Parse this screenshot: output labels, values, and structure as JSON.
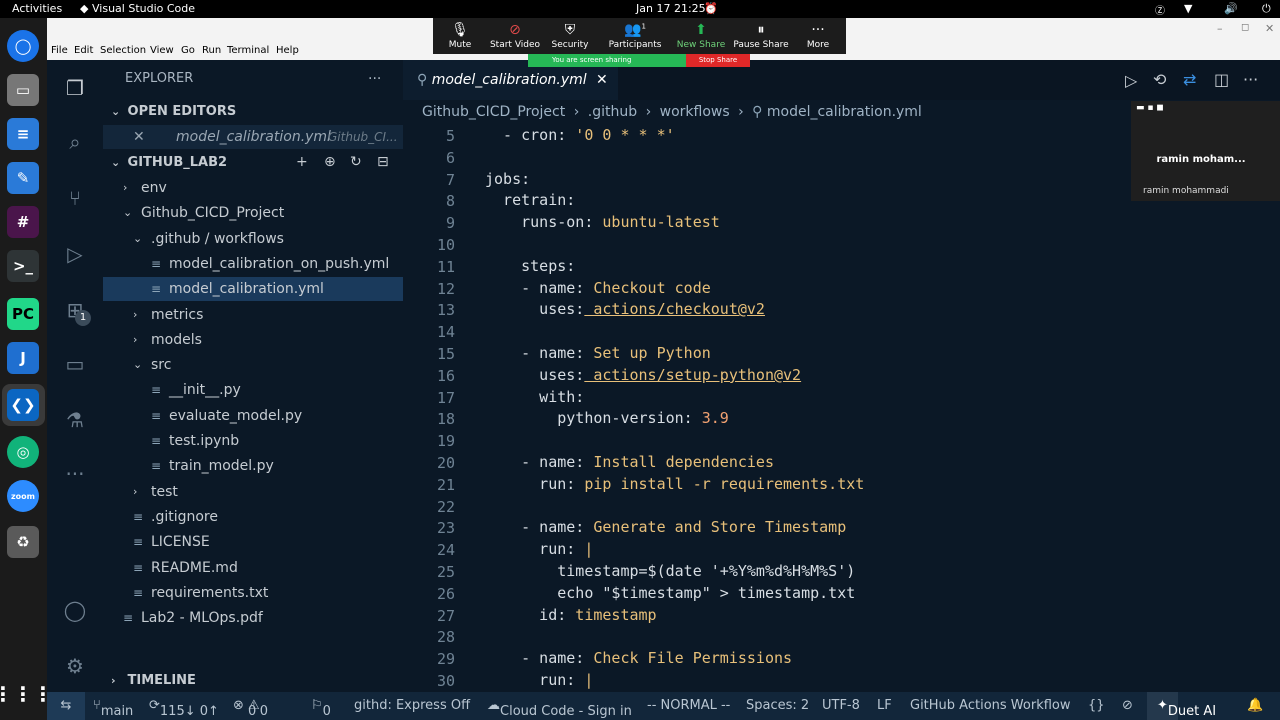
{
  "topbar": {
    "activities": "Activities",
    "app": "Visual Studio Code",
    "clock": "Jan 17  21:25"
  },
  "menu": [
    "File",
    "Edit",
    "Selection",
    "View",
    "Go",
    "Run",
    "Terminal",
    "Help"
  ],
  "zoom": {
    "buttons": [
      "Mute",
      "Start Video",
      "Security",
      "Participants",
      "New Share",
      "Pause Share",
      "More"
    ],
    "participants_count": "1",
    "sharing": "You are screen sharing",
    "stop": "Stop Share"
  },
  "video": {
    "name_short": "ramin moham...",
    "name_full": "ramin mohammadi"
  },
  "explorer": {
    "title": "EXPLORER",
    "open_editors": "OPEN EDITORS",
    "open_file": "model_calibration.yml",
    "open_file_path": "Github_CI...",
    "workspace": "GITHUB_LAB2",
    "timeline": "TIMELINE",
    "tree": [
      {
        "label": "env",
        "depth": 1,
        "type": "folder",
        "open": false
      },
      {
        "label": "Github_CICD_Project",
        "depth": 1,
        "type": "folder",
        "open": true
      },
      {
        "label": ".github / workflows",
        "depth": 2,
        "type": "folder",
        "open": true
      },
      {
        "label": "model_calibration_on_push.yml",
        "depth": 3,
        "type": "file"
      },
      {
        "label": "model_calibration.yml",
        "depth": 3,
        "type": "file",
        "selected": true
      },
      {
        "label": "metrics",
        "depth": 2,
        "type": "folder",
        "open": false
      },
      {
        "label": "models",
        "depth": 2,
        "type": "folder",
        "open": false
      },
      {
        "label": "src",
        "depth": 2,
        "type": "folder",
        "open": true
      },
      {
        "label": "__init__.py",
        "depth": 3,
        "type": "file"
      },
      {
        "label": "evaluate_model.py",
        "depth": 3,
        "type": "file"
      },
      {
        "label": "test.ipynb",
        "depth": 3,
        "type": "file"
      },
      {
        "label": "train_model.py",
        "depth": 3,
        "type": "file"
      },
      {
        "label": "test",
        "depth": 2,
        "type": "folder",
        "open": false
      },
      {
        "label": ".gitignore",
        "depth": 2,
        "type": "file"
      },
      {
        "label": "LICENSE",
        "depth": 2,
        "type": "file"
      },
      {
        "label": "README.md",
        "depth": 2,
        "type": "file"
      },
      {
        "label": "requirements.txt",
        "depth": 2,
        "type": "file"
      },
      {
        "label": "Lab2 - MLOps.pdf",
        "depth": 1,
        "type": "file"
      }
    ]
  },
  "editor": {
    "tab": "model_calibration.yml",
    "breadcrumb": [
      "Github_CICD_Project",
      ".github",
      "workflows",
      "model_calibration.yml"
    ]
  },
  "code": [
    {
      "n": "5",
      "t": "  - cron: '0 0 * * *'"
    },
    {
      "n": "6",
      "t": ""
    },
    {
      "n": "7",
      "t": "jobs:"
    },
    {
      "n": "8",
      "t": "  retrain:"
    },
    {
      "n": "9",
      "t": "    runs-on: ubuntu-latest"
    },
    {
      "n": "10",
      "t": ""
    },
    {
      "n": "11",
      "t": "    steps:"
    },
    {
      "n": "12",
      "t": "    - name: Checkout code"
    },
    {
      "n": "13",
      "t": "      uses: actions/checkout@v2"
    },
    {
      "n": "14",
      "t": ""
    },
    {
      "n": "15",
      "t": "    - name: Set up Python"
    },
    {
      "n": "16",
      "t": "      uses: actions/setup-python@v2"
    },
    {
      "n": "17",
      "t": "      with:"
    },
    {
      "n": "18",
      "t": "        python-version: 3.9"
    },
    {
      "n": "19",
      "t": ""
    },
    {
      "n": "20",
      "t": "    - name: Install dependencies"
    },
    {
      "n": "21",
      "t": "      run: pip install -r requirements.txt"
    },
    {
      "n": "22",
      "t": ""
    },
    {
      "n": "23",
      "t": "    - name: Generate and Store Timestamp"
    },
    {
      "n": "24",
      "t": "      run: |"
    },
    {
      "n": "25",
      "t": "        timestamp=$(date '+%Y%m%d%H%M%S')"
    },
    {
      "n": "26",
      "t": "        echo \"$timestamp\" > timestamp.txt"
    },
    {
      "n": "27",
      "t": "      id: timestamp"
    },
    {
      "n": "28",
      "t": ""
    },
    {
      "n": "29",
      "t": "    - name: Check File Permissions"
    },
    {
      "n": "30",
      "t": "      run: |"
    }
  ],
  "status": {
    "branch": "main",
    "sync": "115↓ 0↑",
    "errors": "0",
    "warnings": "0",
    "ports": "0",
    "githd": "githd: Express Off",
    "cloud": "Cloud Code - Sign in",
    "mode": "-- NORMAL --",
    "spaces": "Spaces: 2",
    "enc": "UTF-8",
    "eol": "LF",
    "lang": "GitHub Actions Workflow",
    "duet": "Duet AI"
  },
  "dock": {
    "badge": "1"
  }
}
